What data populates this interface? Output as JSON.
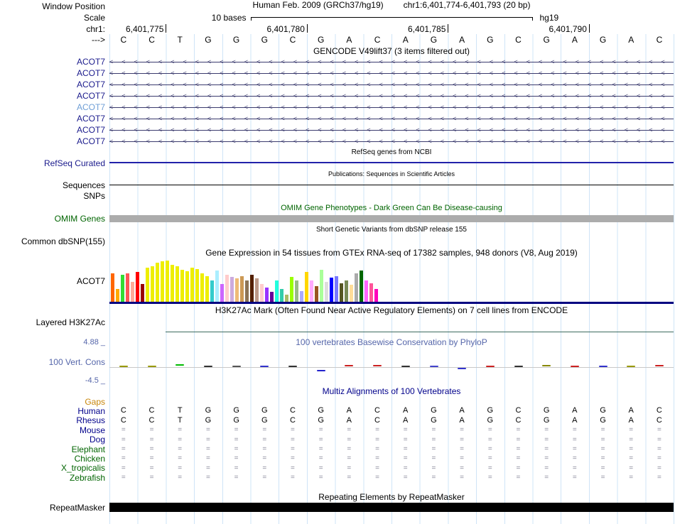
{
  "header": {
    "window_position_label": "Window Position",
    "assembly_title": "Human Feb. 2009 (GRCh37/hg19)",
    "position_range": "chr1:6,401,774-6,401,793 (20 bp)",
    "scale_label": "Scale",
    "scale_value": "10 bases",
    "assembly_short": "hg19",
    "chrom_label": "chr1:",
    "coordinate_ticks": [
      {
        "label": "6,401,775",
        "base_index": 2
      },
      {
        "label": "6,401,780",
        "base_index": 7
      },
      {
        "label": "6,401,785",
        "base_index": 12
      },
      {
        "label": "6,401,790",
        "base_index": 17
      }
    ],
    "strand_label": "--->",
    "sequence": [
      "C",
      "C",
      "T",
      "G",
      "G",
      "G",
      "C",
      "G",
      "A",
      "C",
      "A",
      "G",
      "A",
      "G",
      "C",
      "G",
      "A",
      "G",
      "A",
      "C"
    ]
  },
  "tracks": {
    "gencode": {
      "title": "GENCODE V49lift37 (3 items filtered out)",
      "items": [
        {
          "label": "ACOT7",
          "highlighted": false
        },
        {
          "label": "ACOT7",
          "highlighted": false
        },
        {
          "label": "ACOT7",
          "highlighted": false
        },
        {
          "label": "ACOT7",
          "highlighted": false
        },
        {
          "label": "ACOT7",
          "highlighted": true
        },
        {
          "label": "ACOT7",
          "highlighted": false
        },
        {
          "label": "ACOT7",
          "highlighted": false
        },
        {
          "label": "ACOT7",
          "highlighted": false
        }
      ]
    },
    "refseq": {
      "title": "RefSeq genes from NCBI",
      "label": "RefSeq Curated"
    },
    "publications": {
      "title": "Publications: Sequences in Scientific Articles",
      "label": "Sequences"
    },
    "snps": {
      "label": "SNPs"
    },
    "omim": {
      "title": "OMIM Gene Phenotypes - Dark Green Can Be Disease-causing",
      "label": "OMIM Genes",
      "bar_color": "#acacac"
    },
    "dbsnp": {
      "title": "Short Genetic Variants from dbSNP release 155",
      "label": "Common dbSNP(155)"
    },
    "gtex": {
      "title": "Gene Expression in 54 tissues from GTEx RNA-seq of 17382 samples, 948 donors (V8, Aug 2019)",
      "label": "ACOT7"
    },
    "h3k27ac": {
      "title": "H3K27Ac Mark (Often Found Near Active Regulatory Elements) on 7 cell lines from ENCODE",
      "label": "Layered H3K27Ac"
    },
    "phylop": {
      "title": "100 vertebrates Basewise Conservation by PhyloP",
      "label": "100 Vert. Cons",
      "max_label": "4.88 _",
      "min_label": "-4.5 _",
      "values": [
        0.3,
        0.2,
        0.8,
        0.2,
        0.3,
        0.2,
        0.3,
        -1.2,
        0.4,
        0.4,
        0.2,
        0.3,
        -0.6,
        0.3,
        0.2,
        0.4,
        0.3,
        0.3,
        0.2,
        0.4
      ],
      "colors": [
        "#999900",
        "#999900",
        "#00bb00",
        "#333333",
        "#555555",
        "#3333cc",
        "#333333",
        "#2222cc",
        "#cc2222",
        "#cc2222",
        "#333333",
        "#4444cc",
        "#3333cc",
        "#cc2222",
        "#333333",
        "#888800",
        "#cc2222",
        "#3333cc",
        "#999900",
        "#cc2222"
      ]
    },
    "multiz": {
      "title": "Multiz Alignments of 100 Vertebrates",
      "rows": [
        {
          "label": "Gaps",
          "label_color": "#c8860a",
          "cells": [
            "",
            "",
            "",
            "",
            "",
            "",
            "",
            "",
            "",
            "",
            "",
            "",
            "",
            "",
            "",
            "",
            "",
            "",
            "",
            ""
          ]
        },
        {
          "label": "Human",
          "label_color": "#00008b",
          "cells": [
            "C",
            "C",
            "T",
            "G",
            "G",
            "G",
            "C",
            "G",
            "A",
            "C",
            "A",
            "G",
            "A",
            "G",
            "C",
            "G",
            "A",
            "G",
            "A",
            "C"
          ]
        },
        {
          "label": "Rhesus",
          "label_color": "#00008b",
          "cells": [
            "C",
            "C",
            "T",
            "G",
            "G",
            "G",
            "C",
            "G",
            "A",
            "C",
            "A",
            "G",
            "A",
            "G",
            "C",
            "G",
            "A",
            "G",
            "A",
            "C"
          ]
        },
        {
          "label": "Mouse",
          "label_color": "#00008b",
          "cells": [
            "=",
            "=",
            "=",
            "=",
            "=",
            "=",
            "=",
            "=",
            "=",
            "=",
            "=",
            "=",
            "=",
            "=",
            "=",
            "=",
            "=",
            "=",
            "=",
            "="
          ]
        },
        {
          "label": "Dog",
          "label_color": "#00008b",
          "cells": [
            "=",
            "=",
            "=",
            "=",
            "=",
            "=",
            "=",
            "=",
            "=",
            "=",
            "=",
            "=",
            "=",
            "=",
            "=",
            "=",
            "=",
            "=",
            "=",
            "="
          ]
        },
        {
          "label": "Elephant",
          "label_color": "#006400",
          "cells": [
            "=",
            "=",
            "=",
            "=",
            "=",
            "=",
            "=",
            "=",
            "=",
            "=",
            "=",
            "=",
            "=",
            "=",
            "=",
            "=",
            "=",
            "=",
            "=",
            "="
          ]
        },
        {
          "label": "Chicken",
          "label_color": "#006400",
          "cells": [
            "=",
            "=",
            "=",
            "=",
            "=",
            "=",
            "=",
            "=",
            "=",
            "=",
            "=",
            "=",
            "=",
            "=",
            "=",
            "=",
            "=",
            "=",
            "=",
            "="
          ]
        },
        {
          "label": "X_tropicalis",
          "label_color": "#006400",
          "cells": [
            "=",
            "=",
            "=",
            "=",
            "=",
            "=",
            "=",
            "=",
            "=",
            "=",
            "=",
            "=",
            "=",
            "=",
            "=",
            "=",
            "=",
            "=",
            "=",
            "="
          ]
        },
        {
          "label": "Zebrafish",
          "label_color": "#006400",
          "cells": [
            "=",
            "=",
            "=",
            "=",
            "=",
            "=",
            "=",
            "=",
            "=",
            "=",
            "=",
            "=",
            "=",
            "=",
            "=",
            "=",
            "=",
            "=",
            "=",
            "="
          ]
        }
      ]
    },
    "repeatmasker": {
      "title": "Repeating Elements by RepeatMasker",
      "label": "RepeatMasker",
      "bar_color": "#000000"
    }
  },
  "chart_data": {
    "type": "bar",
    "title": "Gene Expression in 54 tissues from GTEx RNA-seq of 17382 samples, 948 donors (V8, Aug 2019)",
    "gene_label": "ACOT7",
    "bar_count": 54,
    "values_unit": "pixel-height-estimate",
    "values": [
      40,
      18,
      38,
      40,
      28,
      42,
      25,
      48,
      50,
      55,
      57,
      58,
      52,
      50,
      45,
      43,
      48,
      46,
      40,
      36,
      30,
      44,
      25,
      38,
      35,
      33,
      36,
      30,
      38,
      33,
      25,
      20,
      14,
      30,
      18,
      10,
      35,
      30,
      15,
      42,
      30,
      22,
      45,
      28,
      34,
      36,
      26,
      30,
      24,
      40,
      44,
      30,
      26,
      18
    ],
    "colors": [
      "#FF6600",
      "#FFAA00",
      "#33DD33",
      "#FF5555",
      "#FFAA99",
      "#FF0000",
      "#990000",
      "#EEEE00",
      "#EEEE00",
      "#EEEE00",
      "#EEEE00",
      "#EEEE00",
      "#EEEE00",
      "#EEEE00",
      "#EEEE00",
      "#EEEE00",
      "#EEEE00",
      "#EEEE00",
      "#EEEE00",
      "#EEEE00",
      "#33CCCC",
      "#AAEEFF",
      "#CC66FF",
      "#FFCCCC",
      "#CCAADD",
      "#EEBB77",
      "#CC9955",
      "#8B7355",
      "#522000",
      "#BB9988",
      "#FFCCCC",
      "#9933FF",
      "#660099",
      "#22FFDD",
      "#33CCAA",
      "#AABB66",
      "#99FF00",
      "#99BB88",
      "#AAAAFF",
      "#FFD700",
      "#FFAAFF",
      "#995522",
      "#AAFF99",
      "#DDDDDD",
      "#0000FF",
      "#7777FF",
      "#555522",
      "#778855",
      "#FFDD99",
      "#AAAAAA",
      "#006600",
      "#FF66FF",
      "#FF5599",
      "#FF00BB"
    ],
    "baseline_color": "#000080",
    "legend_position": "none",
    "grid": false
  }
}
